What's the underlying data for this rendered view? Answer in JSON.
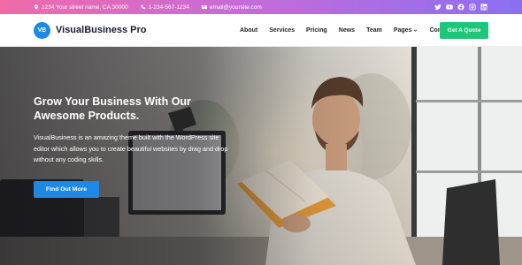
{
  "topbar": {
    "address": "1234 Your street name, CA 30000",
    "phone": "1-234-567-1234",
    "email": "email@yoursite.com",
    "socials": [
      "twitter-icon",
      "youtube-icon",
      "facebook-icon",
      "instagram-icon",
      "linkedin-icon"
    ]
  },
  "header": {
    "logo_badge": "VB",
    "logo_text": "VisualBusiness Pro",
    "nav": [
      {
        "label": "About"
      },
      {
        "label": "Services"
      },
      {
        "label": "Pricing"
      },
      {
        "label": "News"
      },
      {
        "label": "Team"
      },
      {
        "label": "Pages"
      },
      {
        "label": "Contact"
      }
    ],
    "cta_label": "Get A Quote"
  },
  "hero": {
    "title": "Grow Your Business With Our Awesome Products.",
    "text": "VisualBusiness is an amazing theme built with the WordPress site editor which allows you to create beautiful websites by drag and drop without any coding skills.",
    "button_label": "Find Out More"
  },
  "colors": {
    "accent_blue": "#1e88e5",
    "cta_green": "#1ec67a",
    "topbar_gradient_start": "#f06ba8",
    "topbar_gradient_end": "#8a6ff0"
  }
}
